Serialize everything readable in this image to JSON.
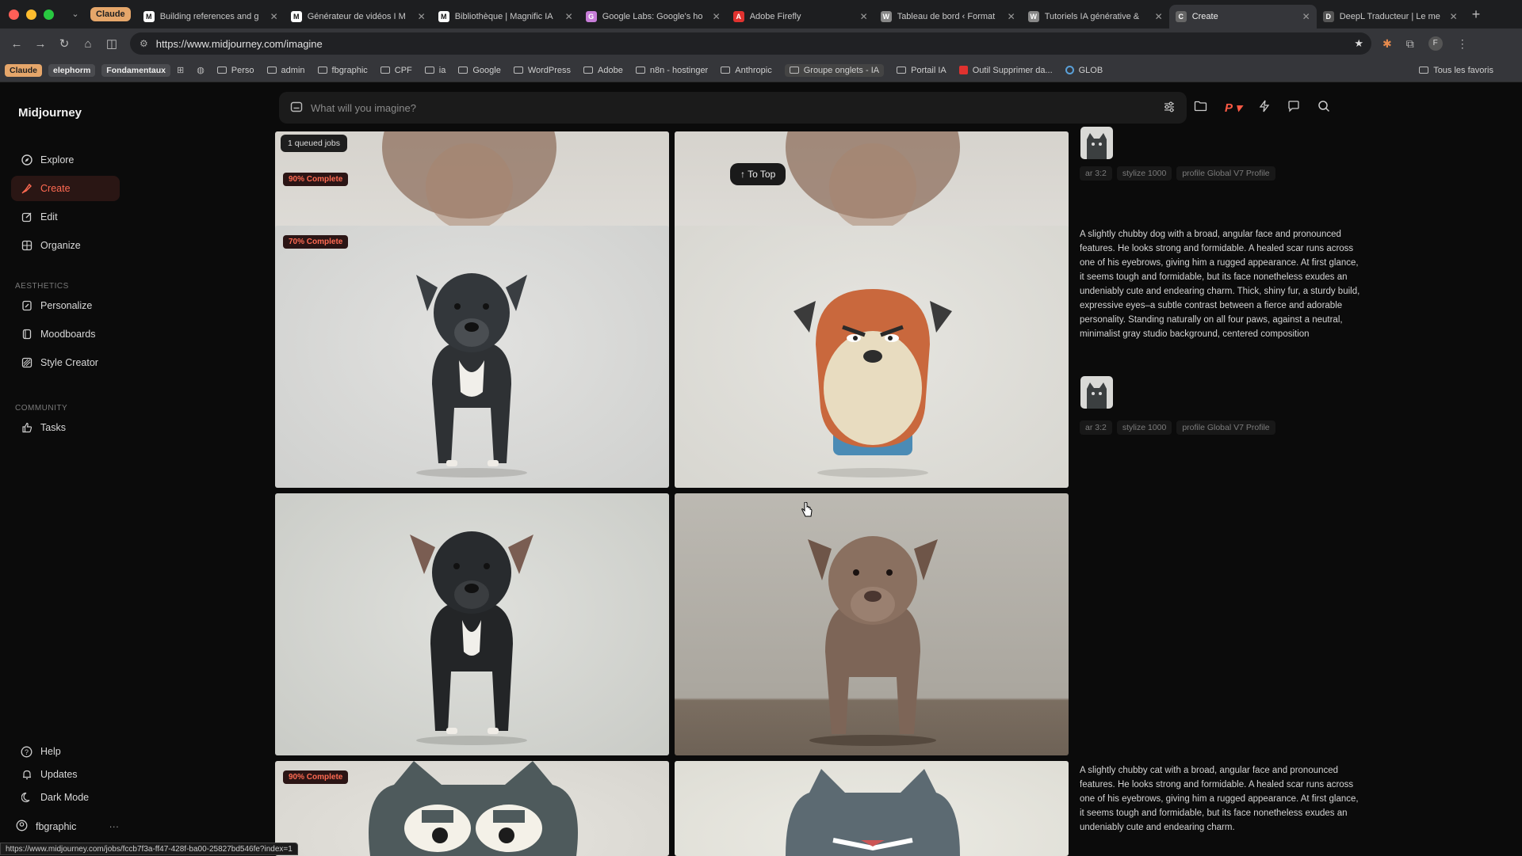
{
  "browser": {
    "tab_group": "Claude",
    "tabs": [
      {
        "label": "Building references and g",
        "icon": "M",
        "color": "#ffffff"
      },
      {
        "label": "Générateur de vidéos I M",
        "icon": "M",
        "color": "#ffffff"
      },
      {
        "label": "Bibliothèque | Magnific IA",
        "icon": "M",
        "color": "#ffffff"
      },
      {
        "label": "Google Labs: Google's ho",
        "icon": "G",
        "color": "#c77dd8"
      },
      {
        "label": "Adobe Firefly",
        "icon": "A",
        "color": "#e0322f"
      },
      {
        "label": "Tableau de bord ‹ Format",
        "icon": "W",
        "color": "#888888"
      },
      {
        "label": "Tutoriels IA générative & ",
        "icon": "W",
        "color": "#888888"
      },
      {
        "label": "Create",
        "icon": "C",
        "color": "#666666",
        "active": true
      },
      {
        "label": "DeepL Traducteur | Le me",
        "icon": "D",
        "color": "#555555"
      }
    ],
    "url": "https://www.midjourney.com/imagine",
    "bookmarks_chips": [
      "Claude",
      "elephorm",
      "Fondamentaux"
    ],
    "bookmarks": [
      "Perso",
      "admin",
      "fbgraphic",
      "CPF",
      "ia",
      "Google",
      "WordPress",
      "Adobe",
      "n8n - hostinger",
      "Anthropic",
      "Groupe onglets - IA",
      "Portail IA"
    ],
    "bookmark_tool": "Outil Supprimer da...",
    "bookmark_glob": "GLOB",
    "bookmarks_right": "Tous les favoris",
    "status_url": "https://www.midjourney.com/jobs/fccb7f3a-ff47-428f-ba00-25827bd546fe?index=1"
  },
  "sidebar": {
    "brand": "Midjourney",
    "nav": [
      {
        "label": "Explore",
        "icon": "compass-icon"
      },
      {
        "label": "Create",
        "icon": "brush-icon",
        "active": true
      },
      {
        "label": "Edit",
        "icon": "edit-icon"
      },
      {
        "label": "Organize",
        "icon": "grid-icon"
      }
    ],
    "aesthetics_title": "AESTHETICS",
    "aesthetics": [
      {
        "label": "Personalize",
        "icon": "personalize-icon"
      },
      {
        "label": "Moodboards",
        "icon": "moodboard-icon"
      },
      {
        "label": "Style Creator",
        "icon": "style-icon"
      }
    ],
    "community_title": "COMMUNITY",
    "community": [
      {
        "label": "Tasks",
        "icon": "thumbs-up-icon"
      }
    ],
    "bottom": [
      {
        "label": "Help",
        "icon": "help-icon"
      },
      {
        "label": "Updates",
        "icon": "bell-icon"
      },
      {
        "label": "Dark Mode",
        "icon": "moon-icon"
      }
    ],
    "user": "fbgraphic"
  },
  "prompt_bar": {
    "placeholder": "What will you imagine?"
  },
  "feed": {
    "queued": "1 queued jobs",
    "to_top": "To Top",
    "badges": [
      "90% Complete",
      "70% Complete",
      "90% Complete"
    ],
    "prompt_dog": "A slightly chubby dog with a broad, angular face and pronounced features. He looks strong and formidable. A healed scar runs across one of his eyebrows, giving him a rugged appearance. At first glance, it seems tough and formidable, but its face nonetheless exudes an undeniably cute and endearing charm. Thick, shiny fur, a sturdy build, expressive eyes–a subtle contrast between a fierce and adorable personality. Standing naturally on all four paws, against a neutral, minimalist gray studio background, centered composition",
    "prompt_cat": "A slightly chubby cat with a broad, angular face and pronounced features. He looks strong and formidable. A healed scar runs across one of his eyebrows, giving him a rugged appearance. At first glance, it seems tough and formidable, but its face nonetheless exudes an undeniably cute and endearing charm.",
    "meta": [
      "ar 3:2",
      "stylize 1000",
      "profile Global V7 Profile"
    ]
  },
  "colors": {
    "accent": "#ff6a52",
    "background": "#0b0b0b"
  }
}
